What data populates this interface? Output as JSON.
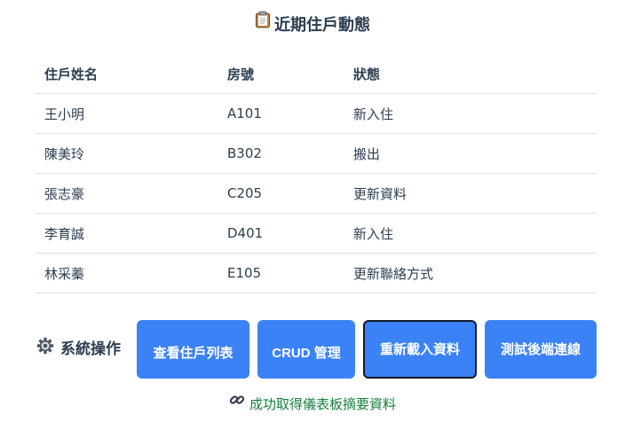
{
  "title": {
    "icon": "clipboard-icon",
    "text": "近期住戶動態"
  },
  "table": {
    "headers": [
      "住戶姓名",
      "房號",
      "狀態"
    ],
    "rows": [
      [
        "王小明",
        "A101",
        "新入住"
      ],
      [
        "陳美玲",
        "B302",
        "搬出"
      ],
      [
        "張志豪",
        "C205",
        "更新資料"
      ],
      [
        "李育誠",
        "D401",
        "新入住"
      ],
      [
        "林采蓁",
        "E105",
        "更新聯絡方式"
      ]
    ]
  },
  "operations": {
    "icon": "gear-icon",
    "label": "系統操作",
    "buttons": [
      {
        "label": "查看住戶列表"
      },
      {
        "label": "CRUD 管理"
      },
      {
        "label": "重新載入資料",
        "active": true
      },
      {
        "label": "測試後端連線"
      }
    ]
  },
  "status": {
    "icon": "link-icon",
    "text": "成功取得儀表板摘要資料",
    "color": "#15803d"
  },
  "colors": {
    "accent": "#3b82f6",
    "text": "#2c3e50",
    "success": "#15803d"
  }
}
